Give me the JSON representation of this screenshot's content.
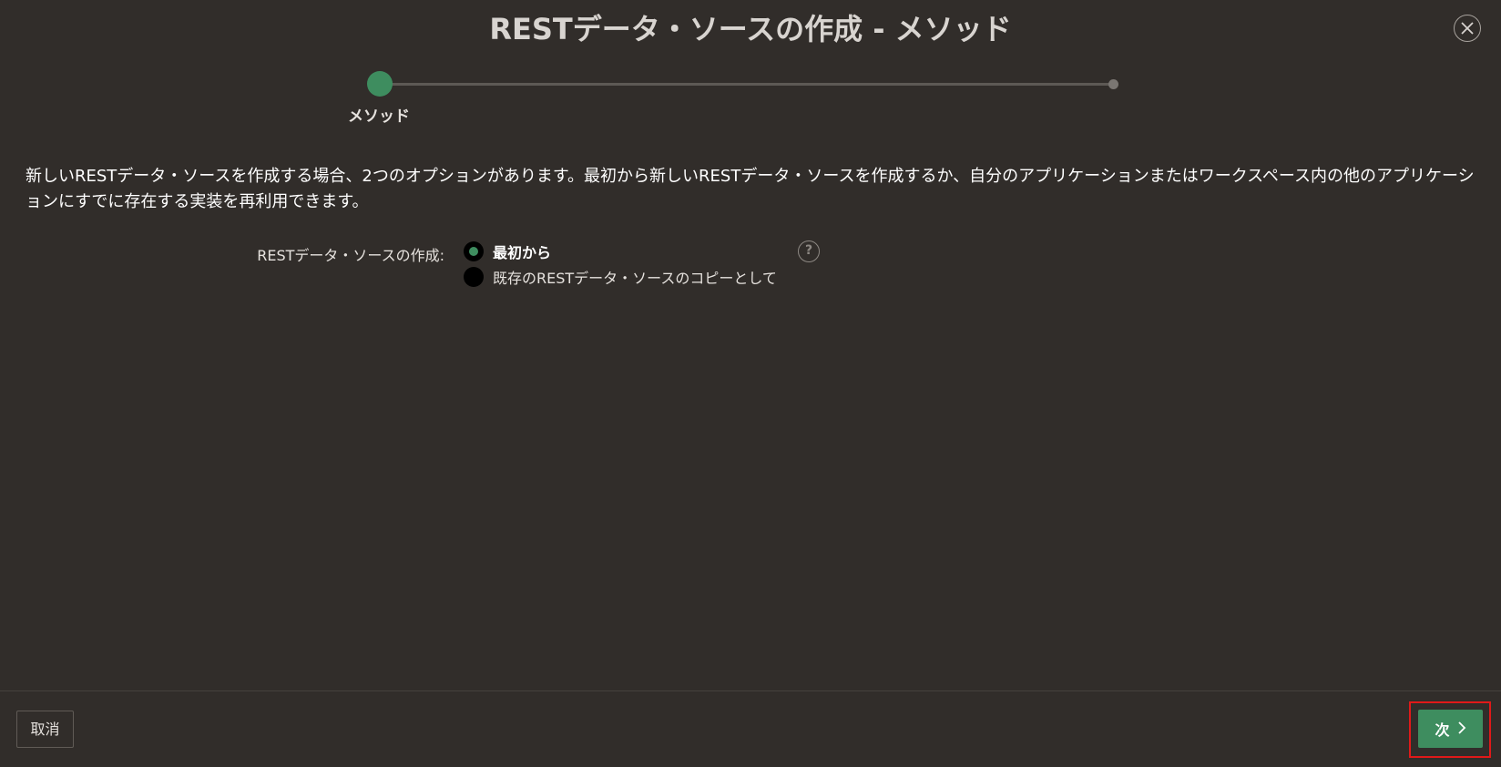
{
  "dialog": {
    "title": "RESTデータ・ソースの作成 - メソッド",
    "close_icon": "close-icon"
  },
  "progress": {
    "current_step_label": "メソッド",
    "current_step": 1,
    "total_steps": 2,
    "accent_color": "#3e8d5f"
  },
  "description": "新しいRESTデータ・ソースを作成する場合、2つのオプションがあります。最初から新しいRESTデータ・ソースを作成するか、自分のアプリケーションまたはワークスペース内の他のアプリケーションにすでに存在する実装を再利用できます。",
  "form": {
    "create_label": "RESTデータ・ソースの作成:",
    "options": [
      {
        "label": "最初から",
        "selected": true
      },
      {
        "label": "既存のRESTデータ・ソースのコピーとして",
        "selected": false
      }
    ],
    "help_text": "?"
  },
  "footer": {
    "cancel_label": "取消",
    "next_label": "次"
  },
  "colors": {
    "background": "#312d2a",
    "primary_button": "#3e8d5f",
    "highlight": "#e01919"
  }
}
